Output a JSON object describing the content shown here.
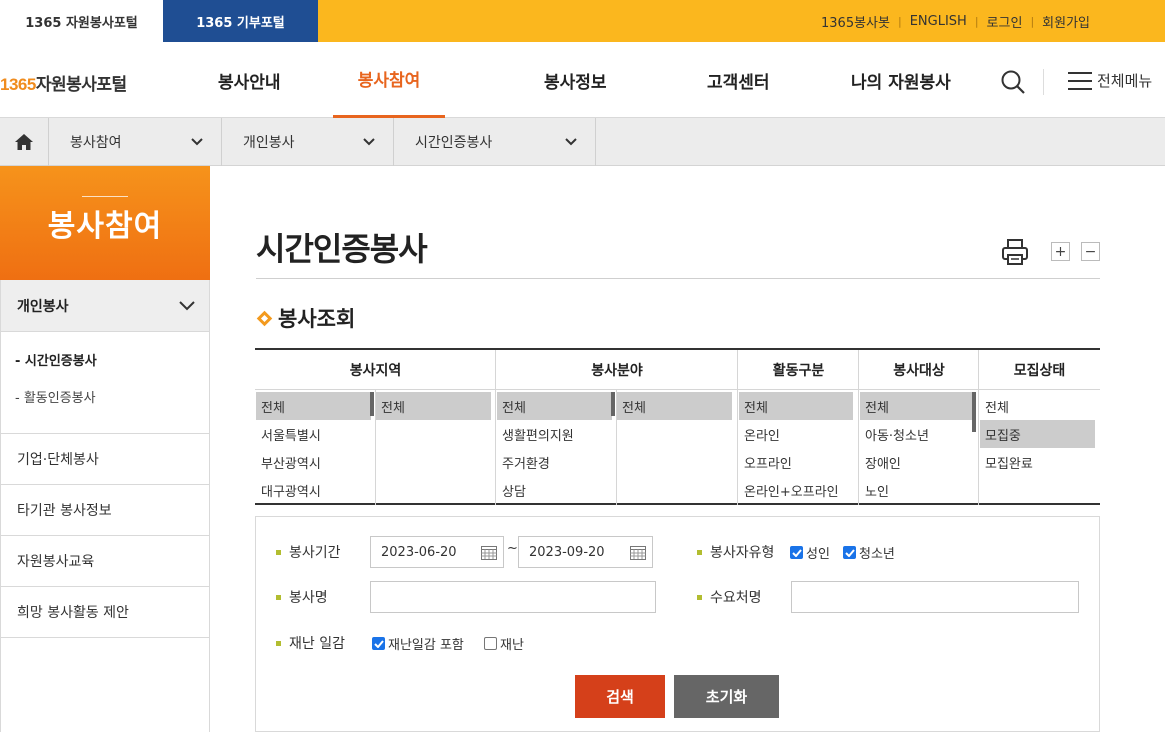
{
  "topbar": {
    "portal_volunteer": "1365 자원봉사포털",
    "portal_donation": "1365 기부포털",
    "util_links": [
      "1365봉사봇",
      "ENGLISH",
      "로그인",
      "회원가입"
    ]
  },
  "header": {
    "logo_num": "1365",
    "logo_text": "자원봉사포털",
    "gnb": [
      "봉사안내",
      "봉사참여",
      "봉사정보",
      "고객센터",
      "나의 자원봉사"
    ],
    "menu_all": "전체메뉴"
  },
  "breadcrumb": [
    "봉사참여",
    "개인봉사",
    "시간인증봉사"
  ],
  "sidebar": {
    "title": "봉사참여",
    "open_group": "개인봉사",
    "sub_items": [
      "- 시간인증봉사",
      "- 활동인증봉사"
    ],
    "items": [
      "기업·단체봉사",
      "타기관 봉사정보",
      "자원봉사교육",
      "희망 봉사활동 제안"
    ]
  },
  "content": {
    "page_title": "시간인증봉사",
    "zoom_in": "+",
    "zoom_out": "−",
    "section_title": "봉사조회"
  },
  "filters": {
    "headers": [
      "봉사지역",
      "봉사분야",
      "활동구분",
      "봉사대상",
      "모집상태"
    ],
    "region_main": [
      "전체",
      "서울특별시",
      "부산광역시",
      "대구광역시"
    ],
    "region_sub": [
      "전체"
    ],
    "field_main": [
      "전체",
      "생활편의지원",
      "주거환경",
      "상담"
    ],
    "field_sub": [
      "전체"
    ],
    "activity": [
      "전체",
      "온라인",
      "오프라인",
      "온라인+오프라인"
    ],
    "target": [
      "전체",
      "아동·청소년",
      "장애인",
      "노인"
    ],
    "status": [
      "전체",
      "모집중",
      "모집완료"
    ]
  },
  "search": {
    "period_label": "봉사기간",
    "date_from": "2023-06-20",
    "date_sep": "~",
    "date_to": "2023-09-20",
    "type_label": "봉사자유형",
    "type_adult": "성인",
    "type_youth": "청소년",
    "name_label": "봉사명",
    "name_value": "",
    "demand_label": "수요처명",
    "demand_value": "",
    "disaster_label": "재난 일감",
    "disaster_include": "재난일감 포함",
    "disaster_only": "재난",
    "search_button": "검색",
    "reset_button": "초기화"
  },
  "colors": {
    "accent_orange": "#e8651e",
    "topbar_yellow": "#fbb71e",
    "donation_blue": "#1f4e93",
    "search_button": "#d5401a",
    "reset_button": "#666666"
  }
}
